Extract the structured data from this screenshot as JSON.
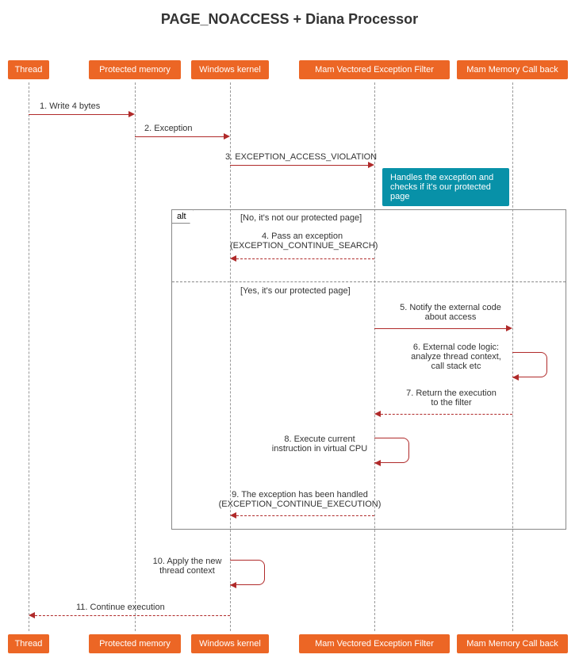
{
  "title": "PAGE_NOACCESS + Diana Processor",
  "participants": {
    "thread": "Thread",
    "memory": "Protected memory",
    "kernel": "Windows kernel",
    "filter": "Mam Vectored Exception Filter",
    "callback": "Mam Memory Call back"
  },
  "messages": {
    "m1": "1. Write 4 bytes",
    "m2": "2. Exception",
    "m3": "3. EXCEPTION_ACCESS_VIOLATION",
    "note": "Handles the exception and checks if it's our protected page",
    "alt_label": "alt",
    "cond_no": "[No, it's not our protected page]",
    "m4a": "4. Pass an exception",
    "m4b": "(EXCEPTION_CONTINUE_SEARCH)",
    "cond_yes": "[Yes, it's our protected page]",
    "m5a": "5. Notify the external code",
    "m5b": "about access",
    "m6a": "6. External code logic:",
    "m6b": "analyze thread context,",
    "m6c": "call stack etc",
    "m7a": "7. Return the execution",
    "m7b": "to the filter",
    "m8a": "8. Execute current",
    "m8b": "instruction in virtual CPU",
    "m9a": "9. The exception has been handled",
    "m9b": "(EXCEPTION_CONTINUE_EXECUTION)",
    "m10a": "10. Apply the new",
    "m10b": "thread context",
    "m11": "11. Continue execution"
  },
  "lanes": {
    "thread": 36,
    "memory": 170,
    "kernel": 290,
    "filter": 472,
    "callback": 646
  }
}
